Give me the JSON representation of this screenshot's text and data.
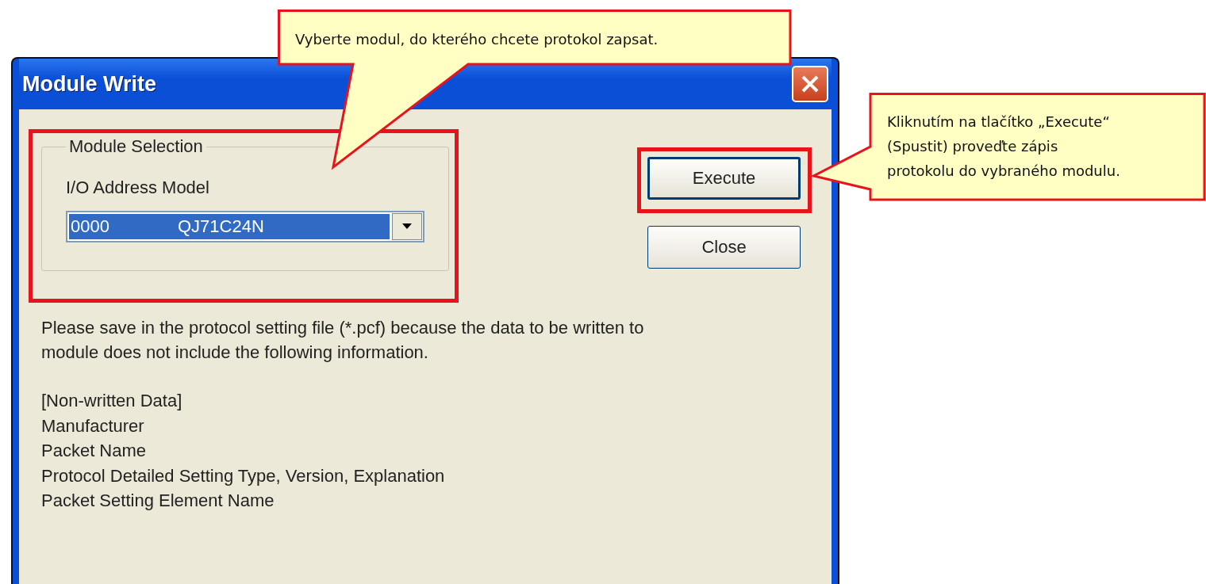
{
  "window": {
    "title": "Module Write"
  },
  "module_selection": {
    "legend": "Module Selection",
    "field_label": "I/O Address Model",
    "combo": {
      "address": "0000",
      "model": "QJ71C24N"
    }
  },
  "buttons": [
    "Execute",
    "Close"
  ],
  "message": [
    "Please save in the protocol setting file (*.pcf) because the data to be written to",
    "module does not include the following information."
  ],
  "non_written": [
    "[Non-written Data]",
    "Manufacturer",
    "Packet Name",
    "Protocol Detailed Setting Type, Version, Explanation",
    "Packet Setting Element Name"
  ],
  "callouts": [
    {
      "lines": [
        "Vyberte modul, do kterého chcete protokol zapsat."
      ]
    },
    {
      "lines": [
        "Kliknutím na tlačítko „Execute“",
        "(Spustit) proveďte zápis",
        "protokolu do vybraného modulu."
      ]
    }
  ]
}
